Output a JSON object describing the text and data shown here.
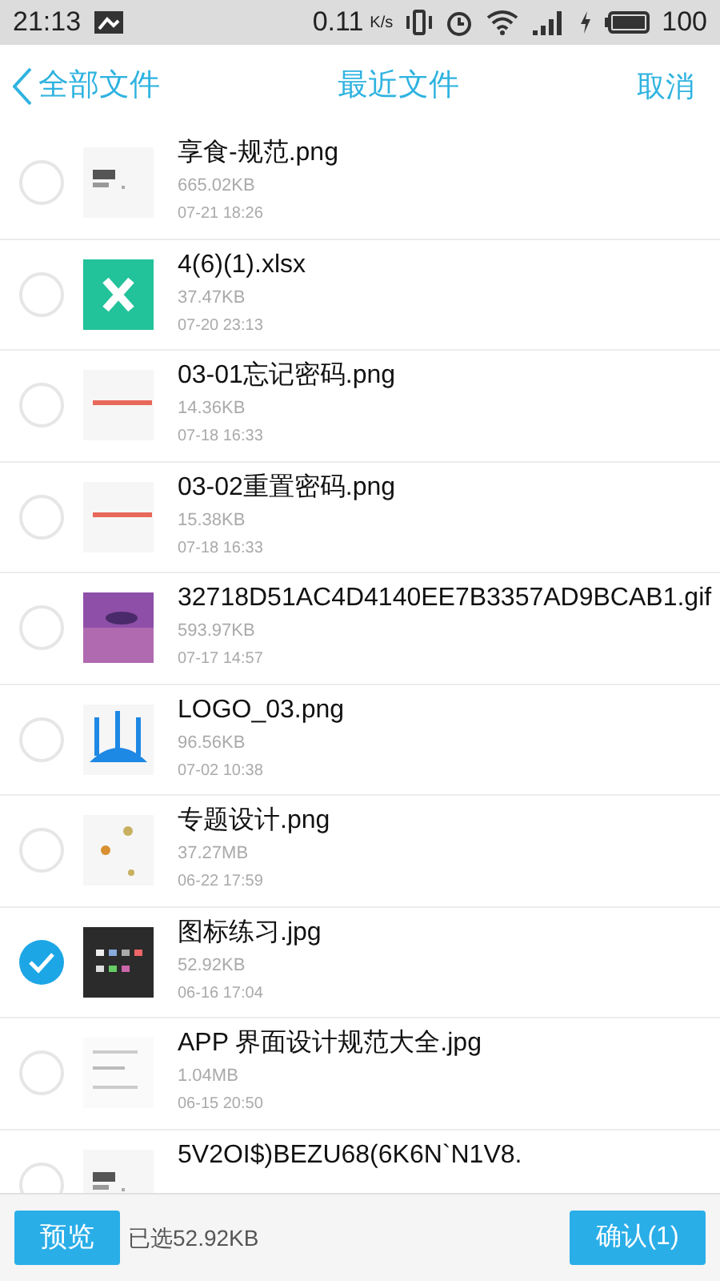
{
  "status_bar": {
    "time": "21:13",
    "speed": "0.11",
    "speed_unit": "K/s",
    "battery": "100"
  },
  "header": {
    "back": "全部文件",
    "title": "最近文件",
    "cancel": "取消"
  },
  "files": [
    {
      "name": "享食-规范.png",
      "size": "665.02KB",
      "date": "07-21 18:26",
      "selected": false,
      "kind": "picture"
    },
    {
      "name": "4(6)(1).xlsx",
      "size": "37.47KB",
      "date": "07-20 23:13",
      "selected": false,
      "kind": "excel"
    },
    {
      "name": "03-01忘记密码.png",
      "size": "14.36KB",
      "date": "07-18 16:33",
      "selected": false,
      "kind": "picture"
    },
    {
      "name": "03-02重置密码.png",
      "size": "15.38KB",
      "date": "07-18 16:33",
      "selected": false,
      "kind": "picture"
    },
    {
      "name": "32718D51AC4D4140EE7B3357AD9BCAB1.gif",
      "size": "593.97KB",
      "date": "07-17 14:57",
      "selected": false,
      "kind": "picture"
    },
    {
      "name": "LOGO_03.png",
      "size": "96.56KB",
      "date": "07-02 10:38",
      "selected": false,
      "kind": "picture"
    },
    {
      "name": "专题设计.png",
      "size": "37.27MB",
      "date": "06-22 17:59",
      "selected": false,
      "kind": "picture"
    },
    {
      "name": "图标练习.jpg",
      "size": "52.92KB",
      "date": "06-16 17:04",
      "selected": true,
      "kind": "picture"
    },
    {
      "name": "APP 界面设计规范大全.jpg",
      "size": "1.04MB",
      "date": "06-15 20:50",
      "selected": false,
      "kind": "picture"
    },
    {
      "name": "5V2OI$)BEZU68(6K6N`N1V8.",
      "selected": false,
      "kind": "picture"
    }
  ],
  "bottom_bar": {
    "preview": "预览",
    "summary": "已选52.92KB",
    "confirm": "确认(1)"
  }
}
